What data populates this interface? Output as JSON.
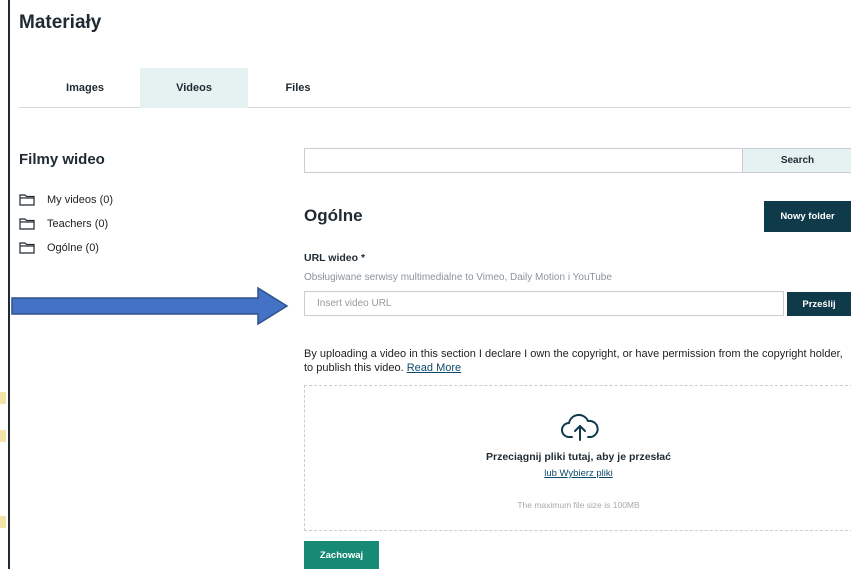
{
  "header": {
    "title": "Materiały"
  },
  "tabs": [
    {
      "label": "Images"
    },
    {
      "label": "Videos",
      "active": true
    },
    {
      "label": "Files"
    }
  ],
  "sidebar": {
    "title": "Filmy wideo",
    "folders": [
      {
        "label": "My videos (0)",
        "icon": "folder-icon"
      },
      {
        "label": "Teachers (0)",
        "icon": "folder-icon"
      },
      {
        "label": "Ogólne (0)",
        "icon": "folder-icon"
      }
    ]
  },
  "search": {
    "value": "",
    "button_label": "Search"
  },
  "section": {
    "title": "Ogólne",
    "new_folder_label": "Nowy folder"
  },
  "url_field": {
    "label": "URL wideo *",
    "help": "Obsługiwane serwisy multimedialne to Vimeo, Daily Motion i YouTube",
    "placeholder": "Insert video URL",
    "submit_label": "Prześlij"
  },
  "declaration": {
    "text": "By uploading a video in this section I declare I own the copyright, or have permission from the copyright holder, to publish this video.",
    "link_label": "Read More"
  },
  "dropzone": {
    "icon": "cloud-upload-icon",
    "title": "Przeciągnij pliki tutaj, aby je przesłać",
    "link_label": "lub Wybierz pliki",
    "max_size": "The maximum file size is 100MB"
  },
  "save_label": "Zachowaj",
  "colors": {
    "primary_dark": "#0e3a4a",
    "save_green": "#168a74",
    "tab_active_bg": "#e6f1f1",
    "annotation_arrow": "#4472c4"
  }
}
